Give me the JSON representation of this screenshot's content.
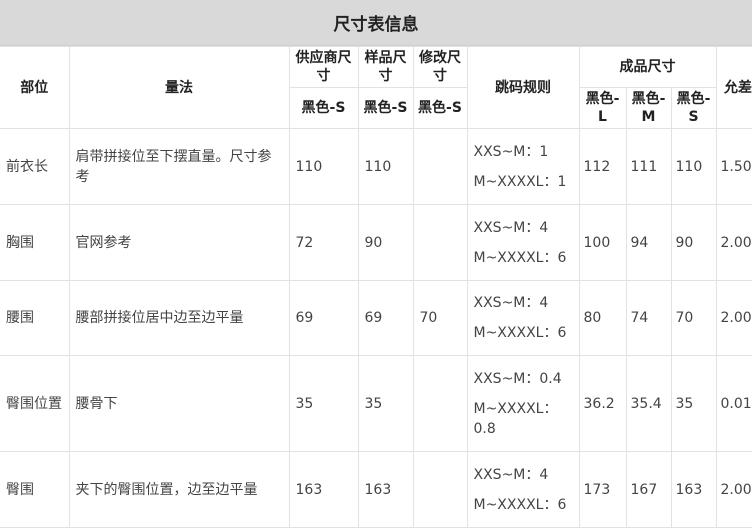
{
  "title": "尺寸表信息",
  "headers": {
    "part": "部位",
    "method": "量法",
    "supplier_size": "供应商尺寸",
    "sample_size": "样品尺寸",
    "modified_size": "修改尺寸",
    "grading_rule": "跳码规则",
    "finished_size": "成品尺寸",
    "tolerance": "允差"
  },
  "subheaders": {
    "supplier": "黑色-S",
    "sample": "黑色-S",
    "modified": "黑色-S",
    "finished_l": "黑色-L",
    "finished_m": "黑色-M",
    "finished_s": "黑色-S"
  },
  "rows": [
    {
      "part": "前衣长",
      "method": "肩带拼接位至下摆直量。尺寸参考",
      "supplier": "110",
      "sample": "110",
      "modified": "",
      "rule1": "XXS~M：1",
      "rule2": "M~XXXXL：1",
      "fl": "112",
      "fm": "111",
      "fs": "110",
      "tol": "1.50"
    },
    {
      "part": "胸围",
      "method": "官网参考",
      "supplier": "72",
      "sample": "90",
      "modified": "",
      "rule1": "XXS~M：4",
      "rule2": "M~XXXXL：6",
      "fl": "100",
      "fm": "94",
      "fs": "90",
      "tol": "2.00"
    },
    {
      "part": "腰围",
      "method": "腰部拼接位居中边至边平量",
      "supplier": "69",
      "sample": "69",
      "modified": "70",
      "rule1": "XXS~M：4",
      "rule2": "M~XXXXL：6",
      "fl": "80",
      "fm": "74",
      "fs": "70",
      "tol": "2.00"
    },
    {
      "part": "臀围位置",
      "method": "腰骨下",
      "supplier": "35",
      "sample": "35",
      "modified": "",
      "rule1": "XXS~M：0.4",
      "rule2": "M~XXXXL：0.8",
      "fl": "36.2",
      "fm": "35.4",
      "fs": "35",
      "tol": "0.01"
    },
    {
      "part": "臀围",
      "method": "夹下的臀围位置，边至边平量",
      "supplier": "163",
      "sample": "163",
      "modified": "",
      "rule1": "XXS~M：4",
      "rule2": "M~XXXXL：6",
      "fl": "173",
      "fm": "167",
      "fs": "163",
      "tol": "2.00"
    }
  ]
}
